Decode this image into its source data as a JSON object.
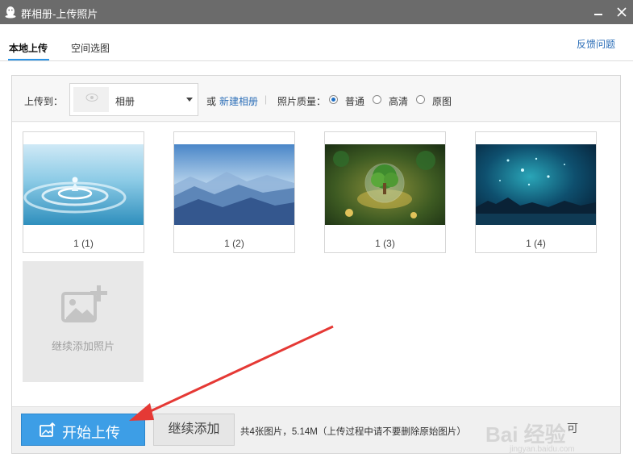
{
  "window": {
    "title": "群相册-上传照片",
    "colors": {
      "titlebar": "#6b6b6b",
      "accent": "#2a93e6",
      "link": "#2d6fb8",
      "annotation_arrow": "#e53935"
    }
  },
  "tabs": {
    "local_upload": "本地上传",
    "space_pick": "空间选图",
    "feedback": "反馈问题"
  },
  "toolbar": {
    "upload_to_label": "上传到：",
    "album_selected": "相册",
    "or_label": "或",
    "new_album_link": "新建相册",
    "separator": "|",
    "quality_label": "照片质量：",
    "quality_options": [
      "普通",
      "高清",
      "原图"
    ],
    "quality_selected": "普通"
  },
  "photos": [
    {
      "caption": "1 (1)",
      "icon": "water-drop-photo"
    },
    {
      "caption": "1 (2)",
      "icon": "mountain-fog-photo"
    },
    {
      "caption": "1 (3)",
      "icon": "tree-in-globe-photo"
    },
    {
      "caption": "1 (4)",
      "icon": "starry-night-photo"
    }
  ],
  "add_tile": {
    "label": "继续添加照片",
    "icon": "add-photo-icon"
  },
  "bottom": {
    "start_button": "开始上传",
    "more_button": "继续添加",
    "summary": "共4张图片，5.14M（上传过程中请不要删除原始图片）",
    "cut_text": "可"
  },
  "watermark": {
    "text": "Bai 经验",
    "sub": "jingyan.baidu.com"
  }
}
